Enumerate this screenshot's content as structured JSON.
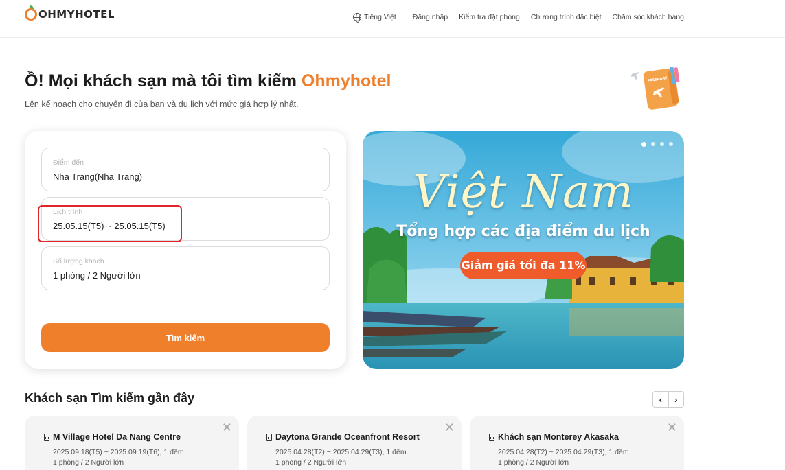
{
  "header": {
    "logo_text": "OHMYHOTEL",
    "nav": {
      "language": "Tiếng Việt",
      "login": "Đăng nhập",
      "check_booking": "Kiểm tra đặt phòng",
      "special_programs": "Chương trình đặc biệt",
      "customer_care": "Chăm sóc khách hàng"
    }
  },
  "hero": {
    "title_prefix": "Ồ! Mọi khách sạn mà tôi tìm kiếm ",
    "title_brand": "Ohmyhotel",
    "subtitle": "Lên kế hoạch cho chuyến đi của bạn và du lịch với mức giá hợp lý nhất.",
    "passport_label": "PASSPORT"
  },
  "search": {
    "destination": {
      "label": "Điểm đến",
      "value": "Nha Trang(Nha Trang)"
    },
    "schedule": {
      "label": "Lịch trình",
      "value": "25.05.15(T5) ~ 25.05.15(T5)"
    },
    "guests": {
      "label": "Số lượng khách",
      "value": "1 phòng / 2 Người lớn"
    },
    "button_label": "Tìm kiếm"
  },
  "banner": {
    "title": "Việt Nam",
    "subtitle": "Tổng hợp các địa điểm du lịch",
    "promo": "Giảm giá tối đa 11%",
    "slide_count": 4,
    "active_slide": 1
  },
  "recent": {
    "title": "Khách sạn Tìm kiếm gần đây",
    "prev_label": "‹",
    "next_label": "›",
    "hotels": [
      {
        "name": "M Village Hotel Da Nang Centre",
        "dates": "2025.09.18(T5) ~ 2025.09.19(T6), 1 đêm",
        "guests": "1 phòng / 2 Người lớn"
      },
      {
        "name": "Daytona Grande Oceanfront Resort",
        "dates": "2025.04.28(T2) ~ 2025.04.29(T3), 1 đêm",
        "guests": "1 phòng / 2 Người lớn"
      },
      {
        "name": "Khách sạn Monterey Akasaka",
        "dates": "2025.04.28(T2) ~ 2025.04.29(T3), 1 đêm",
        "guests": "1 phòng / 2 Người lớn"
      }
    ]
  },
  "colors": {
    "brand_orange": "#f07f2c",
    "highlight_red": "#e0262a",
    "promo_orange": "#ef5b2b"
  }
}
